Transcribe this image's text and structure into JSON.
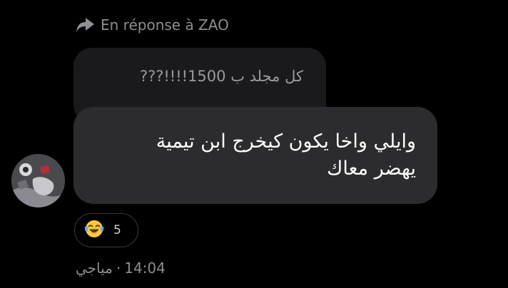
{
  "reply": {
    "label": "En réponse à ZAO",
    "icon": "reply-arrow-icon"
  },
  "quoted_message": {
    "text": "كل مجلد ب 1500!!!!???"
  },
  "message": {
    "line1": "وايلي واخا يكون كيخرج ابن تيمية",
    "line2": "يهضر معاك"
  },
  "avatar": {
    "icon": "user-avatar"
  },
  "reaction": {
    "emoji": "face-with-tears-of-joy-icon",
    "count": "5"
  },
  "meta": {
    "sender": "مياجي",
    "separator": "·",
    "time": "14:04"
  },
  "colors": {
    "background": "#000000",
    "bubble": "#2c2c2e",
    "quoted_bubble": "#1a1a1c",
    "secondary_text": "#8e8e93",
    "emoji_yellow": "#ffc83d"
  }
}
